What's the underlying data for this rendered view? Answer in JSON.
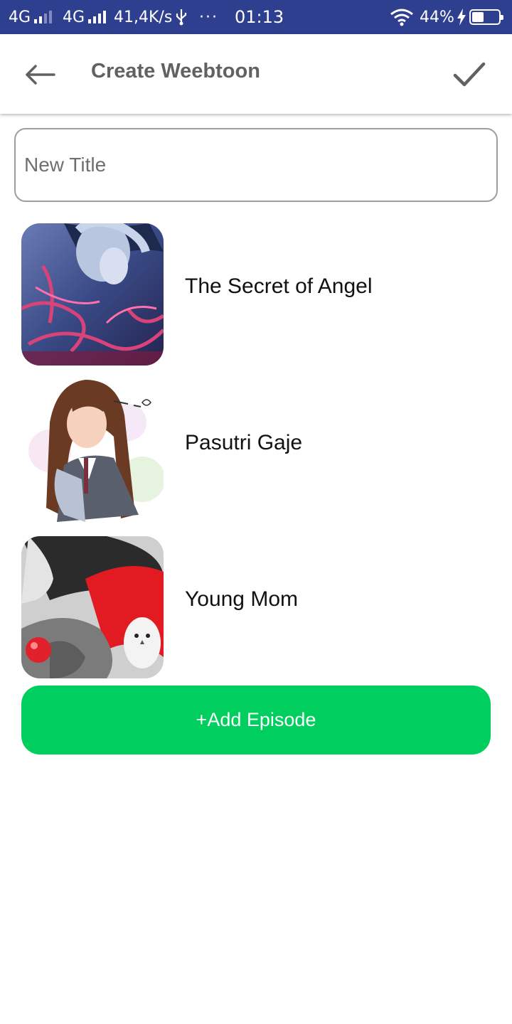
{
  "status_bar": {
    "network1": "4G",
    "network2": "4G",
    "speed": "41,4K/s",
    "more": "···",
    "time": "01:13",
    "battery_percent": "44%",
    "battery_level": 0.44,
    "background_color": "#2f3f8f"
  },
  "app_bar": {
    "back_icon": "arrow-left-icon",
    "title": "Create Weebtoon",
    "confirm_icon": "check-icon"
  },
  "title_input": {
    "placeholder": "New Title",
    "value": ""
  },
  "episodes": [
    {
      "title": "The Secret of Angel",
      "thumbnail": "cover-image"
    },
    {
      "title": "Pasutri Gaje",
      "thumbnail": "cover-image"
    },
    {
      "title": "Young Mom",
      "thumbnail": "cover-image"
    }
  ],
  "add_button": {
    "label": "+Add Episode",
    "color": "#00cf5f"
  }
}
